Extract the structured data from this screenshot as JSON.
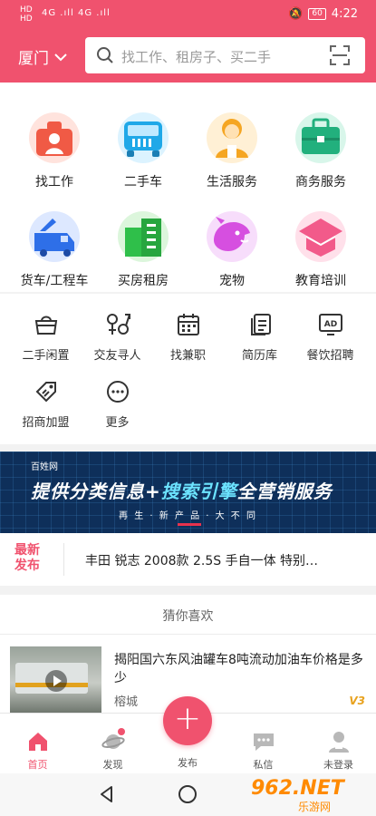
{
  "status_bar": {
    "left_top": "HD",
    "left_bottom": "HD",
    "signal": "4G .ıll 4G .ıll",
    "battery": "60",
    "time": "4:22"
  },
  "header": {
    "city": "厦门",
    "search_placeholder": "找工作、租房子、买二手"
  },
  "categories": [
    {
      "label": "找工作",
      "icon": "job-icon"
    },
    {
      "label": "二手车",
      "icon": "used-car-icon"
    },
    {
      "label": "生活服务",
      "icon": "life-service-icon"
    },
    {
      "label": "商务服务",
      "icon": "business-service-icon"
    },
    {
      "label": "货车/工程车",
      "icon": "truck-icon"
    },
    {
      "label": "买房租房",
      "icon": "house-icon"
    },
    {
      "label": "宠物",
      "icon": "pet-icon"
    },
    {
      "label": "教育培训",
      "icon": "education-icon"
    }
  ],
  "subcategories": [
    {
      "label": "二手闲置",
      "icon": "basket-icon"
    },
    {
      "label": "交友寻人",
      "icon": "friends-icon"
    },
    {
      "label": "找兼职",
      "icon": "calendar-icon"
    },
    {
      "label": "简历库",
      "icon": "resume-icon"
    },
    {
      "label": "餐饮招聘",
      "icon": "ad-icon"
    },
    {
      "label": "招商加盟",
      "icon": "tag-icon"
    },
    {
      "label": "更多",
      "icon": "more-icon"
    }
  ],
  "banner": {
    "brand": "百姓网",
    "title_a": "提供分类信息+",
    "title_b": "搜索引擎",
    "title_c": "全营销服务",
    "subtitle": "再 生 · 新 产 品 · 大 不 同"
  },
  "news": {
    "tag": "最新发布",
    "text": "丰田 锐志 2008款 2.5S 手自一体 特别…"
  },
  "section": {
    "guess_title": "猜你喜欢"
  },
  "listing": {
    "title": "揭阳国六东风油罐车8吨流动加油车价格是多少",
    "location": "榕城",
    "badge": "V3"
  },
  "tabbar": {
    "home": "首页",
    "discover": "发现",
    "publish": "发布",
    "messages": "私信",
    "profile": "未登录"
  },
  "watermark": {
    "main": "962.NET",
    "sub": "乐游网"
  },
  "colors": {
    "brand": "#f0526e",
    "banner_bg": "#0e2f5a"
  }
}
